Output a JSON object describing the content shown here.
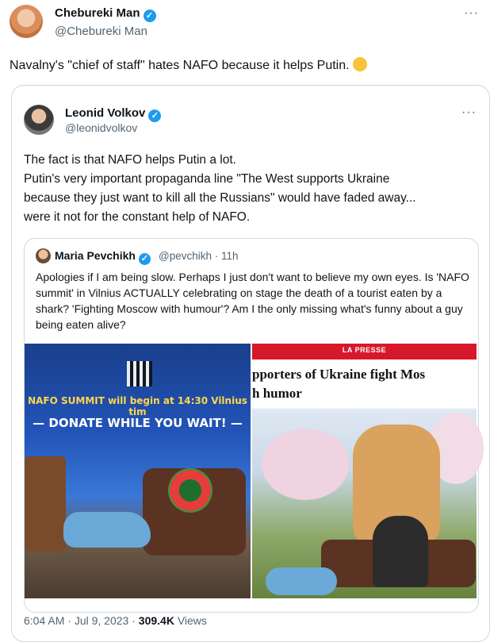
{
  "main_post": {
    "display_name": "Chebureki Man",
    "handle": "@Chebureki Man",
    "text": "Navalny's \"chief of staff\" hates NAFO because it helps Putin.",
    "more": "···"
  },
  "quoted_post": {
    "display_name": "Leonid Volkov",
    "handle": "@leonidvolkov",
    "more": "···",
    "text_lines": [
      "The fact is that NAFO helps Putin a lot.",
      "Putin's very important propaganda line \"The West supports Ukraine",
      "because they just want to kill all the Russians\" would have faded away...",
      "were it not for the constant help of NAFO."
    ],
    "footer": {
      "time": "6:04 AM",
      "date": "Jul 9, 2023",
      "views": "309.4K",
      "views_label": "Views"
    }
  },
  "nested_post": {
    "display_name": "Maria Pevchikh",
    "handle": "@pevchikh · 11h",
    "text": "Apologies if I am being slow. Perhaps I just don't want to believe my own eyes. Is 'NAFO summit' in Vilnius ACTUALLY celebrating on stage the death of a tourist eaten by a shark? 'Fighting Moscow with humour'? Am I the only missing what's funny about a guy being eaten alive?"
  },
  "images": {
    "left": {
      "banner_line1": "NAFO SUMMIT will begin at 14:30 Vilnius tim",
      "banner_line2": "— DONATE WHILE YOU WAIT! —"
    },
    "right": {
      "source": "LA PRESSE",
      "headline": "pporters of Ukraine fight Mos\nh humor"
    }
  },
  "colors": {
    "badge": "#1d9bf0",
    "text": "#0f1419",
    "muted": "#536471",
    "border": "#cfd9de"
  }
}
